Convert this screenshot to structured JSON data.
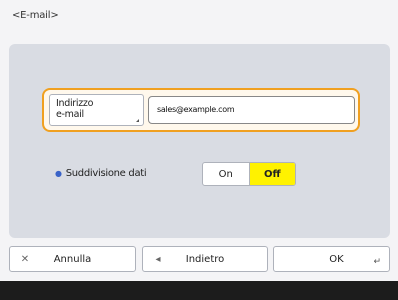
{
  "screen": {
    "title": "<E-mail>"
  },
  "email": {
    "label_line1": "Indirizzo",
    "label_line2": "e-mail",
    "value": "sales@example.com"
  },
  "data_split": {
    "label": "Suddivisione dati",
    "options": [
      "On",
      "Off"
    ],
    "selected": "Off"
  },
  "footer": {
    "cancel_label": "Annulla",
    "back_label": "Indietro",
    "ok_label": "OK"
  },
  "colors": {
    "focus_border": "#f0a020",
    "selected_option": "#fff200",
    "panel": "#d9dce3"
  },
  "icons": {
    "cancel": "close-icon",
    "back": "arrow-left-icon",
    "ok": "enter-icon"
  }
}
